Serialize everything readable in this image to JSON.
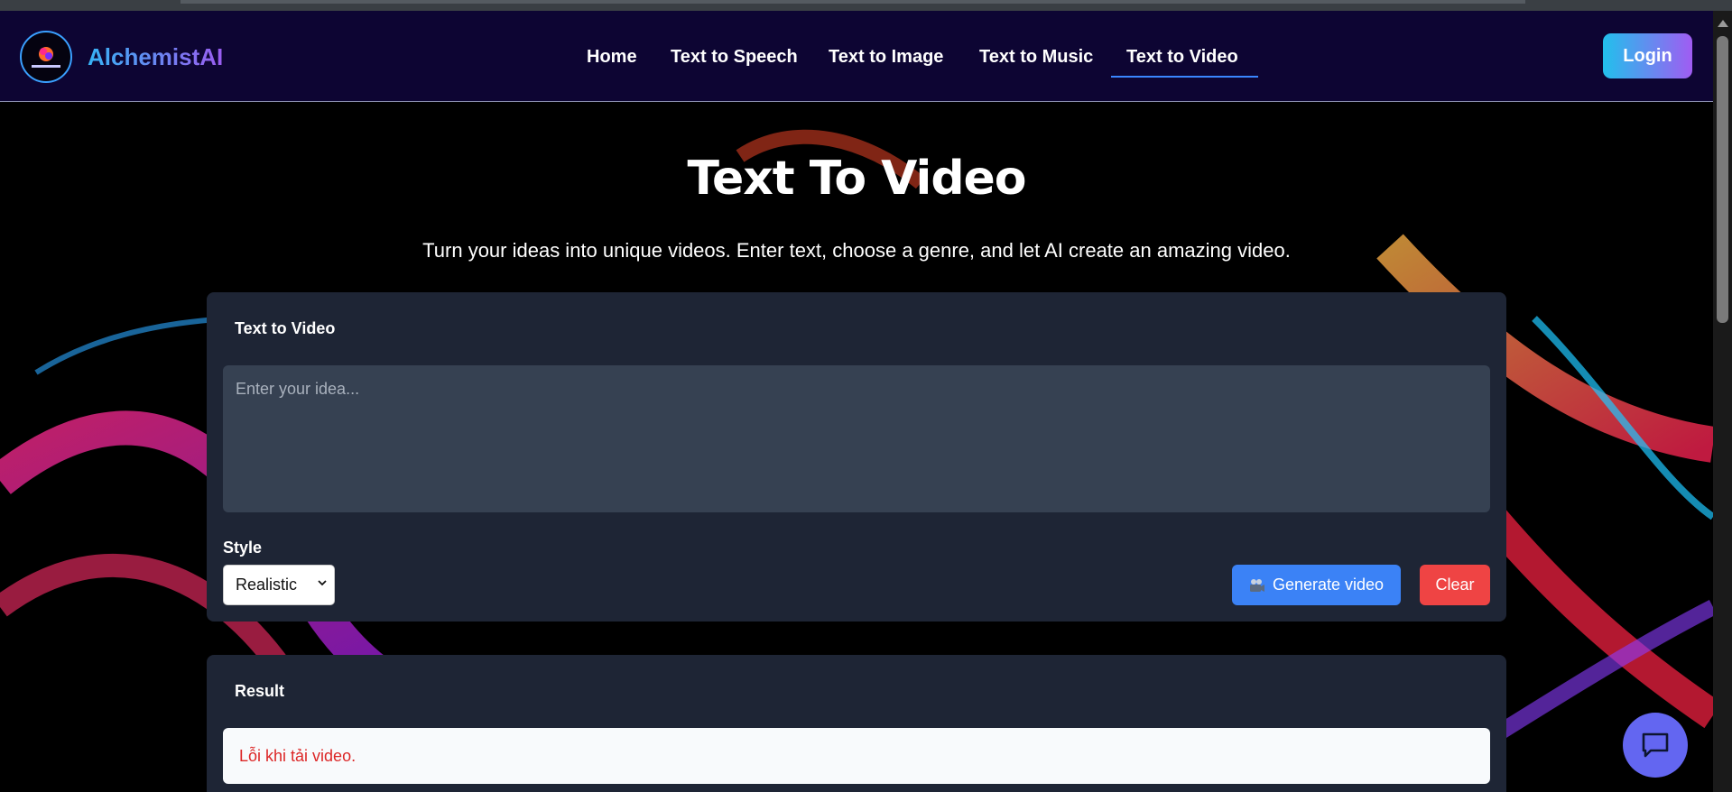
{
  "brand": {
    "name": "AlchemistAI"
  },
  "nav": {
    "items": [
      {
        "label": "Home"
      },
      {
        "label": "Text to Speech"
      },
      {
        "label": "Text to Image"
      },
      {
        "label": "Text to Music"
      },
      {
        "label": "Text to Video",
        "active": true
      }
    ],
    "login_label": "Login"
  },
  "hero": {
    "title": "Text To Video",
    "subtitle": "Turn your ideas into unique videos. Enter text, choose a genre, and let AI create an amazing video."
  },
  "generator": {
    "title": "Text to Video",
    "input_placeholder": "Enter your idea...",
    "input_value": "",
    "style_label": "Style",
    "style_selected": "Realistic",
    "generate_label": "Generate video",
    "generate_icon": "video-camera-icon",
    "clear_label": "Clear"
  },
  "result": {
    "title": "Result",
    "message": "Lỗi khi tải video."
  },
  "colors": {
    "nav_bg": "#0d0533",
    "accent_blue": "#3b82f6",
    "danger": "#ef4444",
    "card_bg": "#1e2535",
    "chat_button": "#6366f1"
  }
}
